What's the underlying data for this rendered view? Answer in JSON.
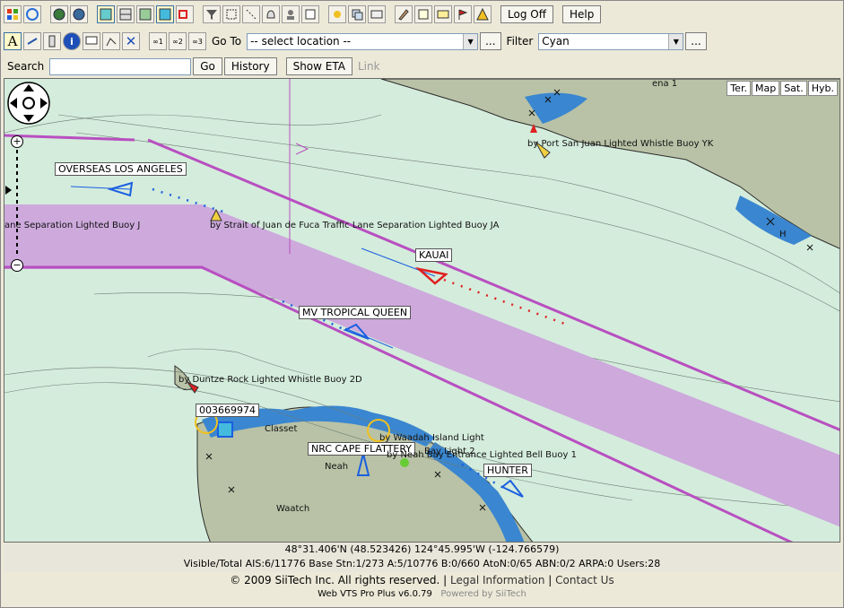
{
  "toolbar": {
    "logoff_label": "Log Off",
    "help_label": "Help",
    "goto_label": "Go To",
    "goto_value": "-- select location --",
    "goto_more": "...",
    "filter_label": "Filter",
    "filter_value": "Cyan",
    "filter_more": "...",
    "search_label": "Search",
    "search_value": "",
    "go_label": "Go",
    "history_label": "History",
    "show_eta_label": "Show ETA",
    "link_label": "Link",
    "text_tool": "A",
    "info_icon": "i",
    "link1": "1",
    "link2": "2",
    "link3": "3"
  },
  "map": {
    "map_types": [
      "Ter.",
      "Map",
      "Sat.",
      "Hyb."
    ],
    "vessels": [
      {
        "name": "OVERSEAS LOS ANGELES"
      },
      {
        "name": "KAUAI"
      },
      {
        "name": "MV TROPICAL QUEEN"
      },
      {
        "name": "003669974"
      },
      {
        "name": "NRC CAPE FLATTERY"
      },
      {
        "name": "HUNTER"
      }
    ],
    "buoys": [
      "by Port San Juan Lighted Whistle Buoy YK",
      "ane Separation Lighted Buoy J",
      "by Strait of Juan de Fuca Traffic Lane Separation Lighted Buoy JA",
      "by Duntze Rock Lighted Whistle Buoy 2D",
      "by Waadah Island Light",
      "Bay Light 2",
      "by Neah Bay Entrance Lighted Bell Buoy 1"
    ],
    "places": [
      "Classet",
      "Neah",
      "Waatch",
      "ena 1",
      "H"
    ]
  },
  "status": {
    "coordinates": "48°31.406'N (48.523426)   124°45.995'W (-124.766579)",
    "counts": "Visible/Total AIS:6/11776  Base Stn:1/273  A:5/10776  B:0/660  AtoN:0/65  ABN:0/2  ARPA:0  Users:28",
    "copyright": "© 2009 SiiTech Inc. All rights reserved.",
    "legal_link": "Legal Information",
    "contact_link": "Contact Us",
    "version": "Web VTS Pro Plus v6.0.79",
    "powered_by": "Powered by SiiTech"
  },
  "colors": {
    "water": "#d4ecdc",
    "lane": "#cda9dc",
    "boundary": "#b84fc0",
    "vessel_blue": "#1a5fe0",
    "vessel_red": "#e02020"
  }
}
